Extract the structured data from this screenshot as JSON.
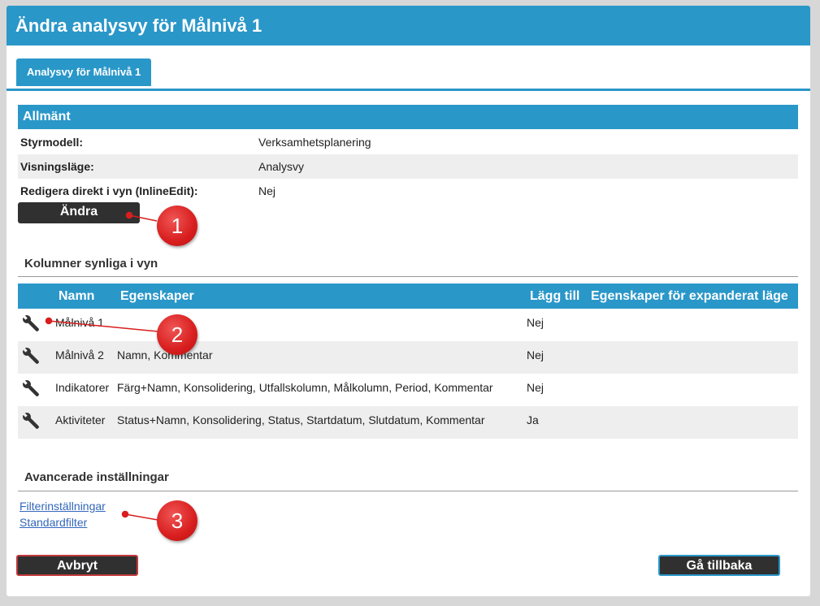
{
  "dialog": {
    "title": "Ändra analysvy för Målnivå 1"
  },
  "tabs": [
    {
      "label": "Analysvy för Målnivå 1"
    }
  ],
  "general": {
    "heading": "Allmänt",
    "rows": [
      {
        "label": "Styrmodell:",
        "value": "Verksamhetsplanering"
      },
      {
        "label": "Visningsläge:",
        "value": "Analysvy"
      },
      {
        "label": "Redigera direkt i vyn (InlineEdit):",
        "value": "Nej"
      }
    ],
    "edit_button": "Ändra"
  },
  "columns": {
    "heading": "Kolumner synliga i vyn",
    "headers": {
      "name": "Namn",
      "properties": "Egenskaper",
      "add": "Lägg till",
      "expanded": "Egenskaper för expanderat läge"
    },
    "rows": [
      {
        "name": "Målnivå 1",
        "properties": "",
        "add": "Nej",
        "expanded": ""
      },
      {
        "name": "Målnivå 2",
        "properties": "Namn, Kommentar",
        "add": "Nej",
        "expanded": ""
      },
      {
        "name": "Indikatorer",
        "properties": "Färg+Namn, Konsolidering, Utfallskolumn, Målkolumn, Period, Kommentar",
        "add": "Nej",
        "expanded": ""
      },
      {
        "name": "Aktiviteter",
        "properties": "Status+Namn, Konsolidering, Status, Startdatum, Slutdatum, Kommentar",
        "add": "Ja",
        "expanded": ""
      }
    ],
    "row_icon": "wrench-icon"
  },
  "advanced": {
    "heading": "Avancerade inställningar",
    "links": [
      "Filterinställningar",
      "Standardfilter"
    ]
  },
  "footer": {
    "cancel_button": "Avbryt",
    "back_button": "Gå tillbaka"
  },
  "callouts": [
    "1",
    "2",
    "3"
  ],
  "colors": {
    "accent": "#2a97c9",
    "button": "#303030",
    "cancel_border": "#c0393b",
    "back_border": "#2a97c9",
    "callout": "#d81e1e"
  }
}
